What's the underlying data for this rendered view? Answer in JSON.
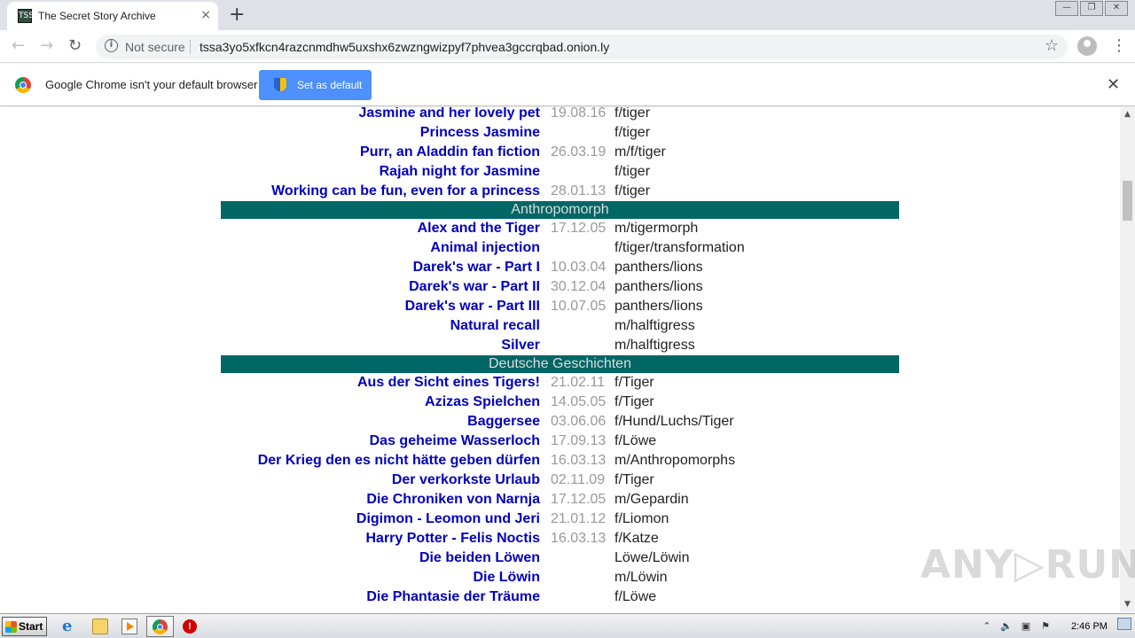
{
  "browser": {
    "tab_title": "The Secret Story Archive",
    "tab_favicon": "archive-favicon",
    "favicon_text": "TSS",
    "tab_close": "×",
    "new_tab": "+",
    "win_minimize": "—",
    "win_restore": "❐",
    "win_close": "✕",
    "back": "←",
    "forward": "→",
    "reload": "↻",
    "info": "i",
    "security_label": "Not secure",
    "url": "tssa3yo5xfkcn4razcnmdhw5uxshx6zwzngwizpyf7phvea3gccrqbad.onion.ly",
    "star": "☆",
    "menu": "⋮"
  },
  "infobar": {
    "message": "Google Chrome isn't your default browser",
    "button_label": "Set as default",
    "close": "✕"
  },
  "stories": {
    "rows": [
      {
        "kind": "story",
        "title": "Jasmine and her lovely pet",
        "date": "19.08.16",
        "tags": "f/tiger"
      },
      {
        "kind": "story",
        "title": "Princess Jasmine",
        "date": "",
        "tags": "f/tiger"
      },
      {
        "kind": "story",
        "title": "Purr, an Aladdin fan fiction",
        "date": "26.03.19",
        "tags": "m/f/tiger"
      },
      {
        "kind": "story",
        "title": "Rajah night for Jasmine",
        "date": "",
        "tags": "f/tiger"
      },
      {
        "kind": "story",
        "title": "Working can be fun, even for a princess",
        "date": "28.01.13",
        "tags": "f/tiger"
      },
      {
        "kind": "category",
        "title": "Anthropomorph"
      },
      {
        "kind": "story",
        "title": "Alex and the Tiger",
        "date": "17.12.05",
        "tags": "m/tigermorph"
      },
      {
        "kind": "story",
        "title": "Animal injection",
        "date": "",
        "tags": "f/tiger/transformation"
      },
      {
        "kind": "story",
        "title": "Darek's war - Part I",
        "date": "10.03.04",
        "tags": "panthers/lions"
      },
      {
        "kind": "story",
        "title": "Darek's war - Part II",
        "date": "30.12.04",
        "tags": "panthers/lions"
      },
      {
        "kind": "story",
        "title": "Darek's war - Part III",
        "date": "10.07.05",
        "tags": "panthers/lions"
      },
      {
        "kind": "story",
        "title": "Natural recall",
        "date": "",
        "tags": "m/halftigress"
      },
      {
        "kind": "story",
        "title": "Silver",
        "date": "",
        "tags": "m/halftigress"
      },
      {
        "kind": "category",
        "title": "Deutsche Geschichten"
      },
      {
        "kind": "story",
        "title": "Aus der Sicht eines Tigers!",
        "date": "21.02.11",
        "tags": "f/Tiger"
      },
      {
        "kind": "story",
        "title": "Azizas Spielchen",
        "date": "14.05.05",
        "tags": "f/Tiger"
      },
      {
        "kind": "story",
        "title": "Baggersee",
        "date": "03.06.06",
        "tags": "f/Hund/Luchs/Tiger"
      },
      {
        "kind": "story",
        "title": "Das geheime Wasserloch",
        "date": "17.09.13",
        "tags": "f/Löwe"
      },
      {
        "kind": "story",
        "title": "Der Krieg den es nicht hätte geben dürfen",
        "date": "16.03.13",
        "tags": "m/Anthropomorphs"
      },
      {
        "kind": "story",
        "title": "Der verkorkste Urlaub",
        "date": "02.11.09",
        "tags": "f/Tiger"
      },
      {
        "kind": "story",
        "title": "Die Chroniken von Narnja",
        "date": "17.12.05",
        "tags": "m/Gepardin"
      },
      {
        "kind": "story",
        "title": "Digimon - Leomon und Jeri",
        "date": "21.01.12",
        "tags": "f/Liomon"
      },
      {
        "kind": "story",
        "title": "Harry Potter - Felis Noctis",
        "date": "16.03.13",
        "tags": "f/Katze"
      },
      {
        "kind": "story",
        "title": "Die beiden Löwen",
        "date": "",
        "tags": "Löwe/Löwin"
      },
      {
        "kind": "story",
        "title": "Die Löwin",
        "date": "",
        "tags": "m/Löwin"
      },
      {
        "kind": "story",
        "title": "Die Phantasie der Träume",
        "date": "",
        "tags": "f/Löwe"
      }
    ]
  },
  "scrollbar": {
    "up": "▲",
    "down": "▼"
  },
  "watermark": "ANY▷RUN",
  "taskbar": {
    "start_label": "Start",
    "ie_glyph": "e",
    "stop_glyph": "!",
    "tray": [
      "⌃",
      "🔈",
      "▣",
      "⚑"
    ],
    "clock": "2:46 PM"
  },
  "colors": {
    "link": "#0000c0",
    "category_band": "#006666",
    "date_text": "#999999",
    "button_blue": "#4d90fe"
  }
}
